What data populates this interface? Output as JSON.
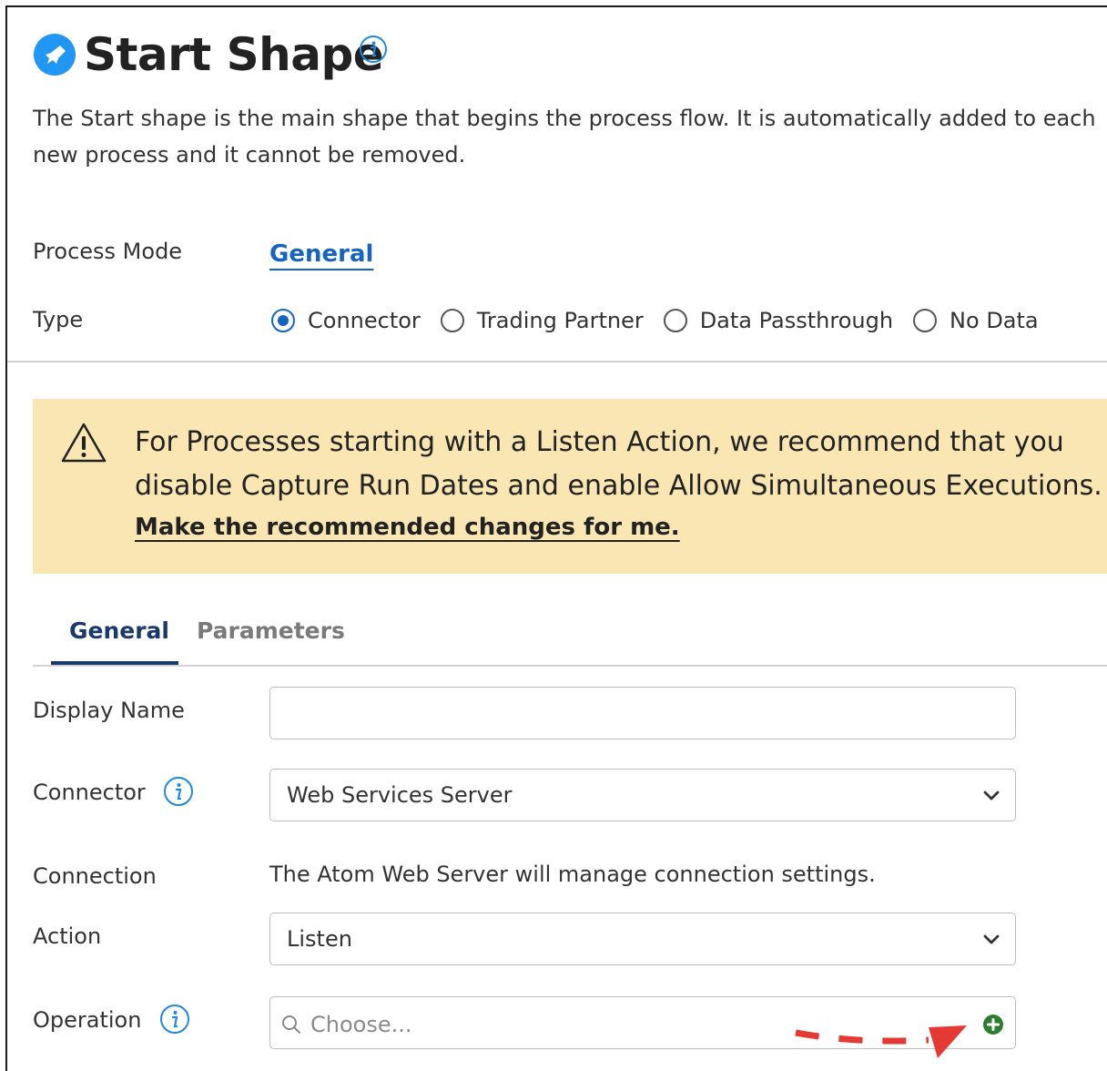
{
  "header": {
    "title": "Start Shape",
    "description": "The Start shape is the main shape that begins the process flow. It is automatically added to each new process and it cannot be removed."
  },
  "process_mode": {
    "label": "Process Mode",
    "value": "General"
  },
  "type": {
    "label": "Type",
    "options": [
      "Connector",
      "Trading Partner",
      "Data Passthrough",
      "No Data"
    ],
    "selected": "Connector"
  },
  "banner": {
    "message": "For Processes starting with a Listen Action, we recommend that you disable Capture Run Dates and enable Allow Simultaneous Executions.",
    "link": "Make the recommended changes for me.",
    "color": "#f9e6b3"
  },
  "tabs": {
    "general": "General",
    "parameters": "Parameters",
    "active": "General"
  },
  "form": {
    "display_name": {
      "label": "Display Name",
      "value": ""
    },
    "connector": {
      "label": "Connector",
      "value": "Web Services Server"
    },
    "connection": {
      "label": "Connection",
      "text": "The Atom Web Server will manage connection settings."
    },
    "action": {
      "label": "Action",
      "value": "Listen"
    },
    "operation": {
      "label": "Operation",
      "placeholder": "Choose..."
    }
  },
  "colors": {
    "accent": "#1565c0",
    "tab_active": "#1a3a6b",
    "add": "#2e7d32",
    "annotation": "#e53935"
  }
}
